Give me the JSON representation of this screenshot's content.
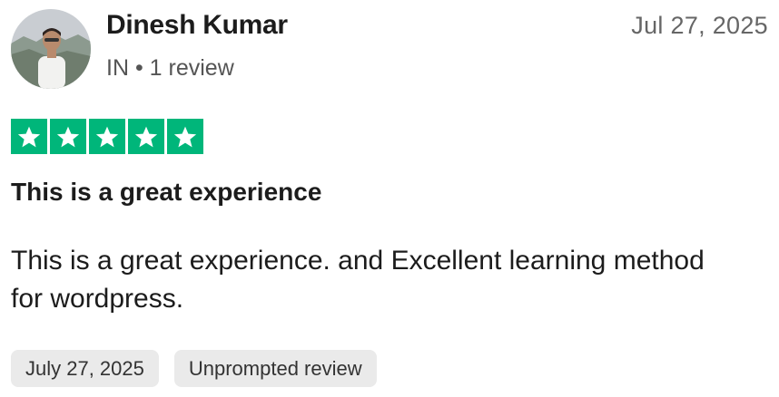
{
  "reviewer": {
    "name": "Dinesh Kumar",
    "country": "IN",
    "separator": "•",
    "review_count": "1 review"
  },
  "review": {
    "date": "Jul 27, 2025",
    "rating": 5,
    "rating_max": 5,
    "title": "This is a great experience",
    "body": "This is a great experience. and Excellent learning method for wordpress.",
    "tags": [
      "July 27, 2025",
      "Unprompted review"
    ]
  },
  "icons": {
    "star": "star-icon",
    "avatar": "avatar-photo"
  },
  "colors": {
    "star_bg": "#00b67a",
    "tag_bg": "#eaeaea"
  }
}
